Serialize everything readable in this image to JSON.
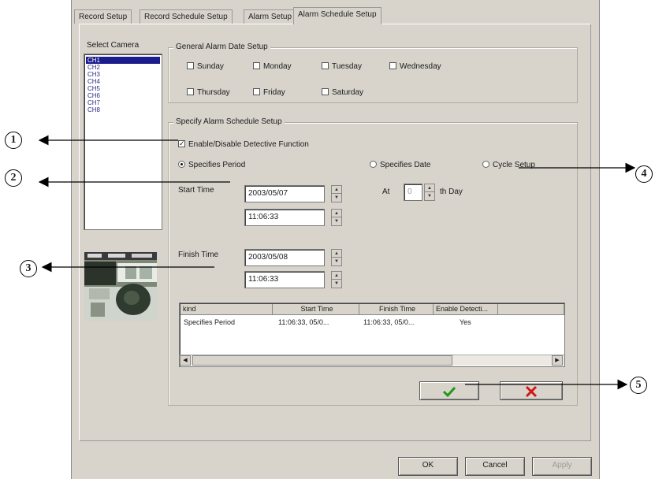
{
  "tabs": [
    {
      "label": "Record Setup"
    },
    {
      "label": "Record Schedule Setup"
    },
    {
      "label": "Alarm Setup"
    },
    {
      "label": "Alarm Schedule Setup",
      "active": true
    }
  ],
  "camera_select": {
    "label": "Select Camera",
    "items": [
      "CH1",
      "CH2",
      "CH3",
      "CH4",
      "CH5",
      "CH6",
      "CH7",
      "CH8"
    ],
    "selected": "CH1"
  },
  "general_alarm_date": {
    "title": "General Alarm Date Setup",
    "days": [
      "Sunday",
      "Monday",
      "Tuesday",
      "Wednesday",
      "Thursday",
      "Friday",
      "Saturday"
    ]
  },
  "specify_schedule": {
    "title": "Specify Alarm Schedule Setup",
    "enable_label": "Enable/Disable Detective Function",
    "enable_checked": true,
    "radio_specifies_period": "Specifies Period",
    "radio_specifies_date": "Specifies Date",
    "radio_cycle_setup": "Cycle Setup",
    "selected_mode": "Specifies Period",
    "start_time_label": "Start Time",
    "start_date": "2003/05/07",
    "start_clock": "11:06:33",
    "finish_time_label": "Finish Time",
    "finish_date": "2003/05/08",
    "finish_clock": "11:06:33",
    "cycle_prefix": "At",
    "cycle_value": "0",
    "cycle_suffix": "th Day"
  },
  "schedule_table": {
    "columns": [
      "kind",
      "Start Time",
      "Finish Time",
      "Enable Detecti..."
    ],
    "rows": [
      [
        "Specifies Period",
        "11:06:33, 05/0...",
        "11:06:33, 05/0...",
        "Yes"
      ]
    ]
  },
  "action_buttons": {
    "confirm_icon": "check-icon",
    "delete_icon": "x-icon",
    "confirm_color": "#1a9a1a",
    "delete_color": "#d01818"
  },
  "footer": {
    "ok": "OK",
    "cancel": "Cancel",
    "apply": "Apply"
  },
  "callouts": [
    "1",
    "2",
    "3",
    "4",
    "5"
  ]
}
